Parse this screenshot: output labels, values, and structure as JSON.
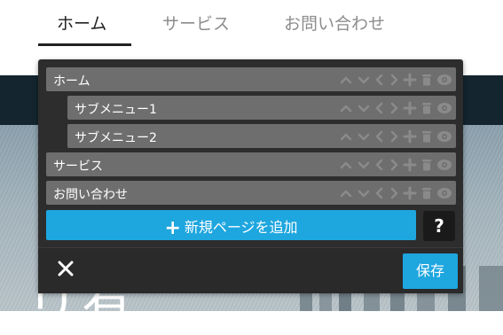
{
  "nav": {
    "tabs": [
      {
        "label": "ホーム",
        "active": true
      },
      {
        "label": "サービス",
        "active": false
      },
      {
        "label": "お問い合わせ",
        "active": false
      }
    ]
  },
  "hero": {
    "text": "リ有"
  },
  "menu_editor": {
    "items": [
      {
        "label": "ホーム",
        "level": 0
      },
      {
        "label": "サブメニュー1",
        "level": 1
      },
      {
        "label": "サブメニュー2",
        "level": 1
      },
      {
        "label": "サービス",
        "level": 0
      },
      {
        "label": "お問い合わせ",
        "level": 0
      }
    ],
    "item_tools": [
      "move-up-icon",
      "move-down-icon",
      "outdent-icon",
      "indent-icon",
      "add-icon",
      "delete-icon",
      "visibility-icon"
    ],
    "add_page_label": "新規ページを追加",
    "add_page_icon": "+",
    "help_label": "?",
    "close_icon": "close-icon",
    "save_label": "保存",
    "colors": {
      "accent": "#1ea6df",
      "panel": "#2d2d2d",
      "row": "#6e6e6e",
      "tool_icon": "#8a8a8a"
    }
  }
}
